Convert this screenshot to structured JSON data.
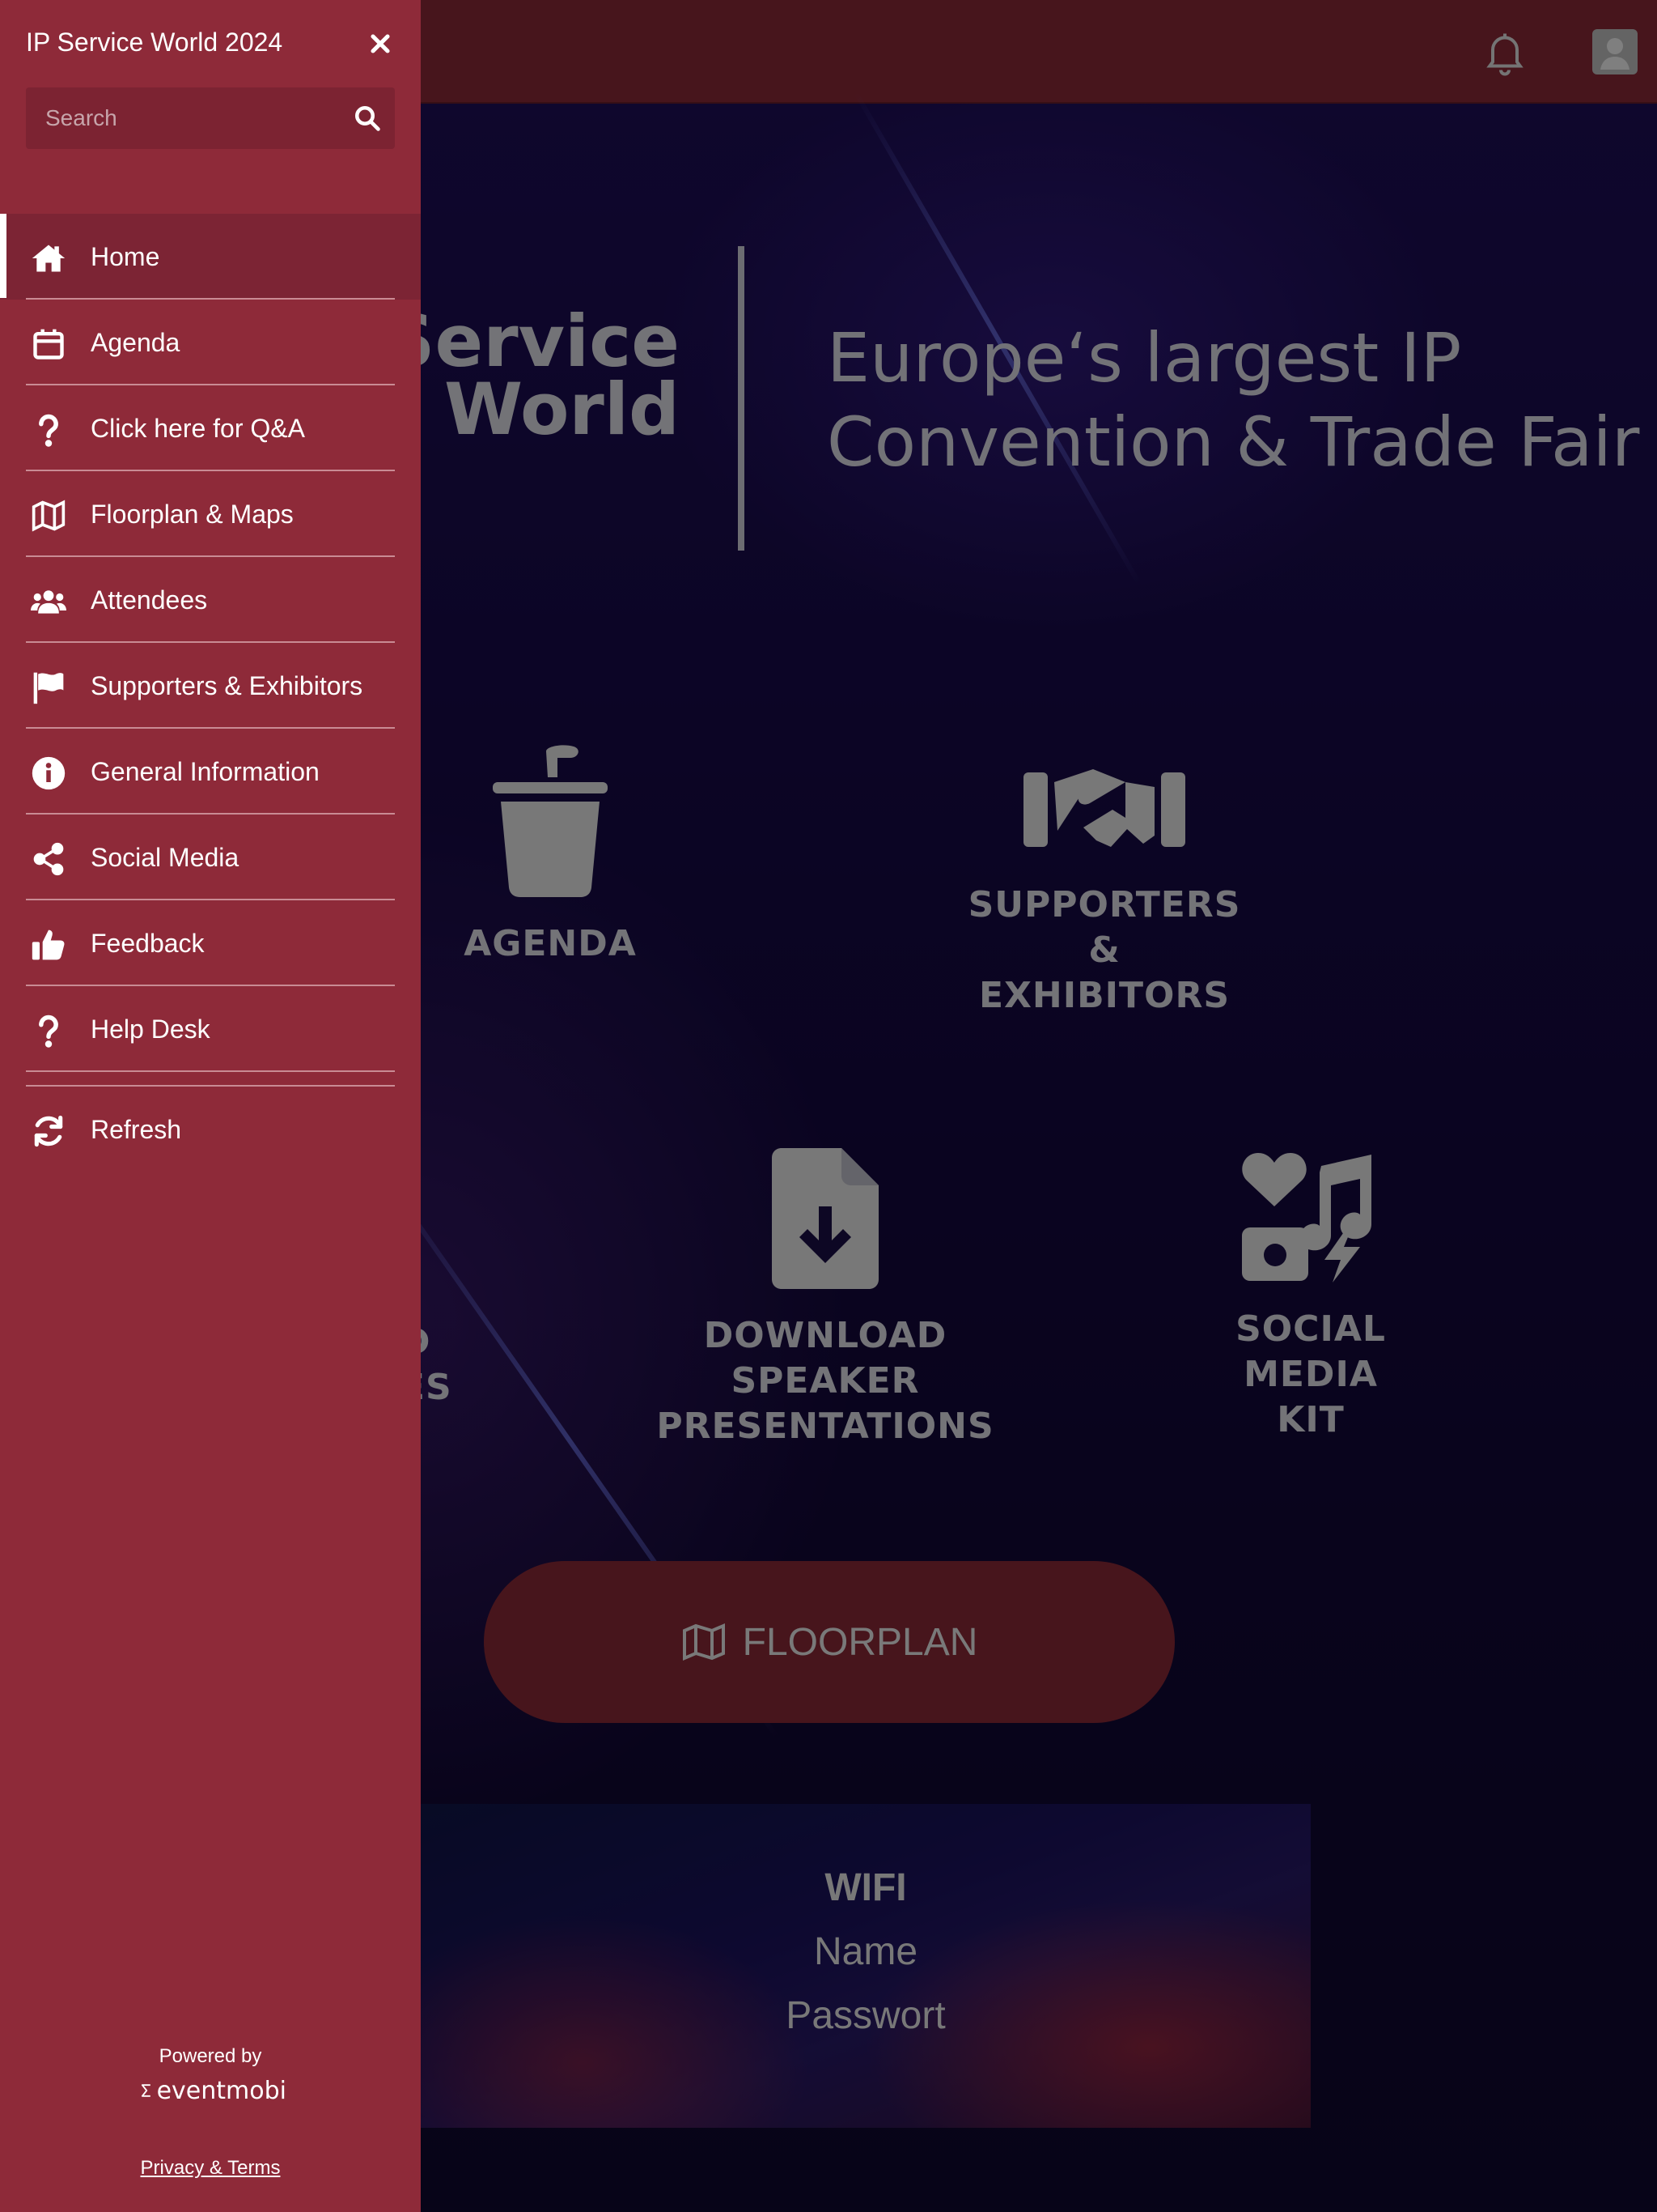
{
  "app": {
    "brand": "Service\nWorld",
    "tagline": "Europe‘s largest IP Convention & Trade Fair",
    "tiles": [
      {
        "label": "AGENDA"
      },
      {
        "label": "SUPPORTERS &\nEXHIBITORS"
      },
      {
        "label": "AD\nRES"
      },
      {
        "label": "DOWNLOAD\nSPEAKER PRESENTATIONS"
      },
      {
        "label": "SOCIAL MEDIA\nKIT"
      }
    ],
    "floorplan_button": "FLOORPLAN",
    "wifi": {
      "title": "WIFI",
      "name_label": "Name",
      "password_label": "Passwort"
    }
  },
  "drawer": {
    "title": "IP Service World 2024",
    "search_placeholder": "Search",
    "items": [
      {
        "label": "Home",
        "icon": "home-icon"
      },
      {
        "label": "Agenda",
        "icon": "calendar-icon"
      },
      {
        "label": "Click here for Q&A",
        "icon": "question-icon"
      },
      {
        "label": "Floorplan & Maps",
        "icon": "map-icon"
      },
      {
        "label": "Attendees",
        "icon": "users-icon"
      },
      {
        "label": "Supporters & Exhibitors",
        "icon": "flag-icon"
      },
      {
        "label": "General Information",
        "icon": "info-icon"
      },
      {
        "label": "Social Media",
        "icon": "share-icon"
      },
      {
        "label": "Feedback",
        "icon": "thumbs-up-icon"
      },
      {
        "label": "Help Desk",
        "icon": "question-icon"
      }
    ],
    "refresh_label": "Refresh",
    "powered_by": "Powered by",
    "eventmobi": "eventmobi",
    "privacy": "Privacy & Terms"
  },
  "colors": {
    "drawer_bg": "#8e2a39",
    "drawer_active": "#7c2434",
    "hero_bg": "#170a48"
  }
}
